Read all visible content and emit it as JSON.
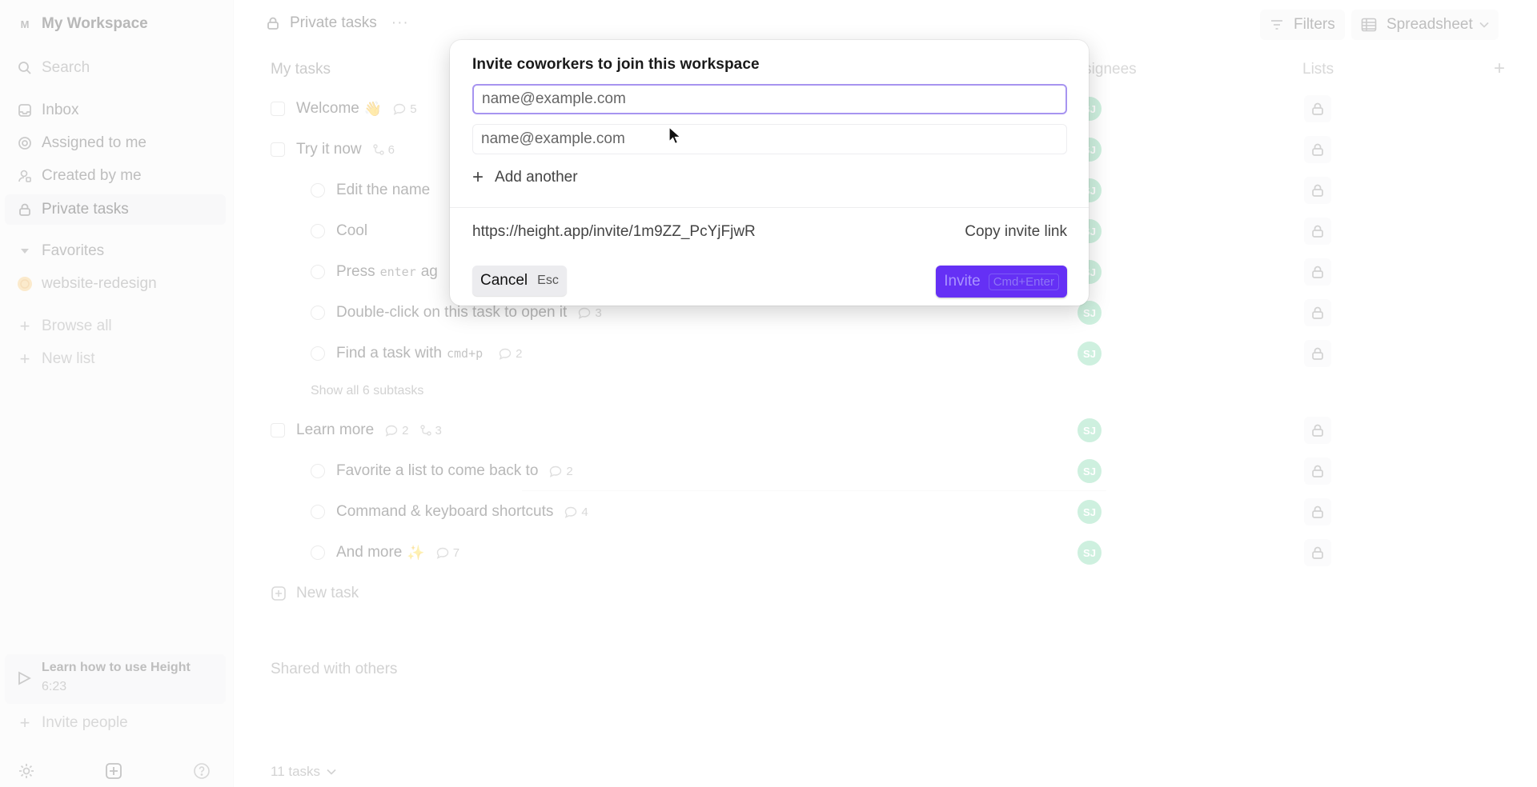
{
  "sidebar": {
    "workspace_initial": "M",
    "workspace_name": "My Workspace",
    "search": "Search",
    "nav": [
      {
        "label": "Inbox",
        "icon": "inbox-icon"
      },
      {
        "label": "Assigned to me",
        "icon": "target-icon"
      },
      {
        "label": "Created by me",
        "icon": "user-icon"
      },
      {
        "label": "Private tasks",
        "icon": "lock-icon",
        "active": true
      }
    ],
    "favorites_label": "Favorites",
    "favorites": [
      {
        "label": "website-redesign",
        "icon": "globe-icon"
      }
    ],
    "browse_all": "Browse all",
    "new_list": "New list",
    "learn_title": "Learn how to use Height",
    "learn_time": "6:23",
    "invite_people": "Invite people"
  },
  "header": {
    "title": "Private tasks",
    "more": "···",
    "filters": "Filters",
    "view": "Spreadsheet"
  },
  "table": {
    "section_title": "My tasks",
    "columns": {
      "assignees": "Assignees",
      "lists": "Lists"
    },
    "tasks": [
      {
        "title": "Welcome",
        "emoji": "👋",
        "comments": "5"
      },
      {
        "title": "Try it now",
        "subtasks": "6"
      },
      {
        "title": "Edit the name",
        "sub": true
      },
      {
        "title": "Cool",
        "sub": true
      },
      {
        "title": "Press",
        "kbd": "enter",
        "suffix": "ag",
        "sub": true
      },
      {
        "title": "Double-click on this task to open it",
        "comments": "3",
        "sub": true
      },
      {
        "title": "Find a task with",
        "kbd": "cmd+p",
        "comments": "2",
        "sub": true
      },
      {
        "title": "Learn more",
        "comments": "2",
        "subtasks": "3"
      },
      {
        "title": "Favorite a list to come back to",
        "comments": "2",
        "sub": true
      },
      {
        "title": "Command & keyboard shortcuts",
        "comments": "4",
        "sub": true
      },
      {
        "title": "And more",
        "emoji": "✨",
        "comments": "7",
        "sub": true
      }
    ],
    "show_all_subtasks": "Show all 6 subtasks",
    "new_task": "New task",
    "shared_section": "Shared with others",
    "task_count": "11 tasks",
    "assignee_initials": "SJ"
  },
  "modal": {
    "title": "Invite coworkers to join this workspace",
    "email_placeholder_1": "name@example.com",
    "email_placeholder_2": "name@example.com",
    "add_another": "Add another",
    "invite_link": "https://height.app/invite/1m9ZZ_PcYjFjwR",
    "copy_invite_link": "Copy invite link",
    "cancel": "Cancel",
    "cancel_shortcut": "Esc",
    "invite": "Invite",
    "invite_shortcut": "Cmd+Enter",
    "accent_color": "#6530f5"
  }
}
